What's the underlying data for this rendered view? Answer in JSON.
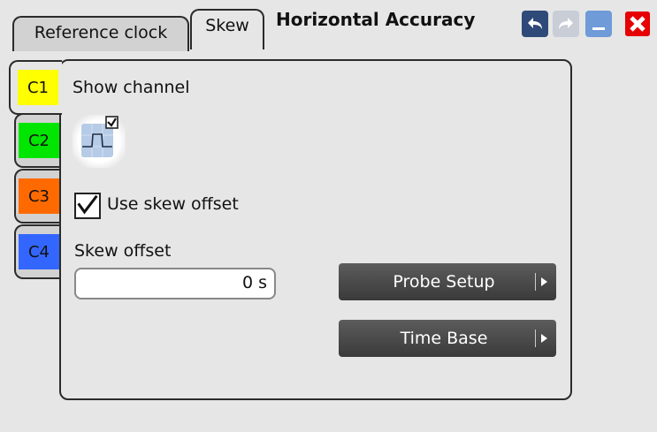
{
  "tabs": {
    "reference_clock": "Reference clock",
    "skew": "Skew"
  },
  "title": "Horizontal Accuracy",
  "toolbar": {
    "undo_icon": "undo-arrow-icon",
    "redo_icon": "redo-arrow-icon",
    "minimize_icon": "minimize-icon",
    "close_icon": "close-x-icon",
    "colors": {
      "undo": "#2f4a78",
      "redo": "#c8cdd6",
      "minimize": "#6f9bd8",
      "close": "#e60000"
    }
  },
  "channels": [
    {
      "label": "C1",
      "color": "#ffff00",
      "selected": true
    },
    {
      "label": "C2",
      "color": "#00e600",
      "selected": false
    },
    {
      "label": "C3",
      "color": "#ff6a00",
      "selected": false
    },
    {
      "label": "C4",
      "color": "#3366ff",
      "selected": false
    }
  ],
  "show_channel": {
    "label": "Show channel",
    "checked": true
  },
  "use_skew_offset": {
    "label": "Use skew offset",
    "checked": true
  },
  "skew_offset": {
    "label": "Skew offset",
    "value": "0 s"
  },
  "buttons": {
    "probe_setup": "Probe Setup",
    "time_base": "Time Base"
  }
}
